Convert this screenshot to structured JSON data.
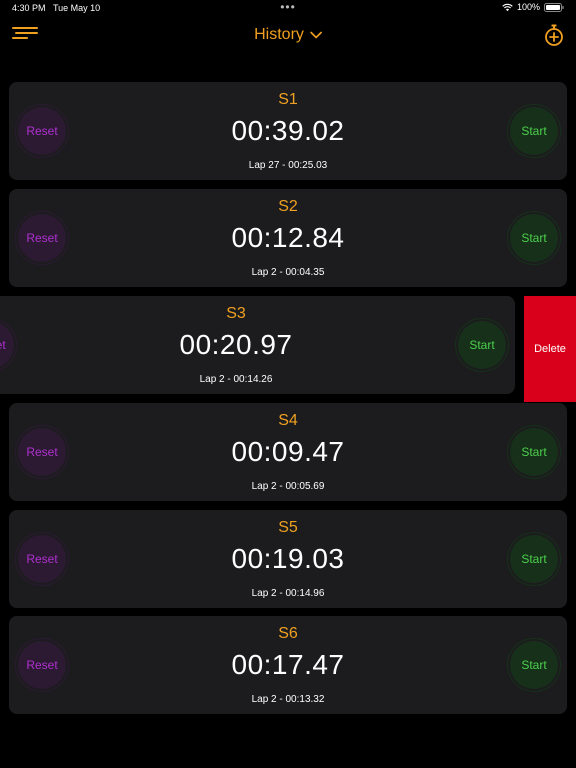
{
  "status_bar": {
    "time": "4:30 PM",
    "date": "Tue May 10",
    "dots": "•••",
    "battery": "100%"
  },
  "nav": {
    "title": "History"
  },
  "colors": {
    "accent": "#f0a020",
    "reset": "#b030d0",
    "start": "#4cd04c",
    "delete": "#d9001b",
    "card_bg": "#1c1c1e"
  },
  "stopwatches": [
    {
      "name": "S1",
      "time": "00:39.02",
      "lap": "Lap 27 - 00:25.03",
      "reset_label": "Reset",
      "start_label": "Start"
    },
    {
      "name": "S2",
      "time": "00:12.84",
      "lap": "Lap 2 - 00:04.35",
      "reset_label": "Reset",
      "start_label": "Start"
    },
    {
      "name": "S3",
      "time": "00:20.97",
      "lap": "Lap 2 - 00:14.26",
      "reset_label": "Reset",
      "start_label": "Start"
    },
    {
      "name": "S4",
      "time": "00:09.47",
      "lap": "Lap 2 - 00:05.69",
      "reset_label": "Reset",
      "start_label": "Start"
    },
    {
      "name": "S5",
      "time": "00:19.03",
      "lap": "Lap 2 - 00:14.96",
      "reset_label": "Reset",
      "start_label": "Start"
    },
    {
      "name": "S6",
      "time": "00:17.47",
      "lap": "Lap 2 - 00:13.32",
      "reset_label": "Reset",
      "start_label": "Start"
    }
  ],
  "delete_label": "Delete"
}
